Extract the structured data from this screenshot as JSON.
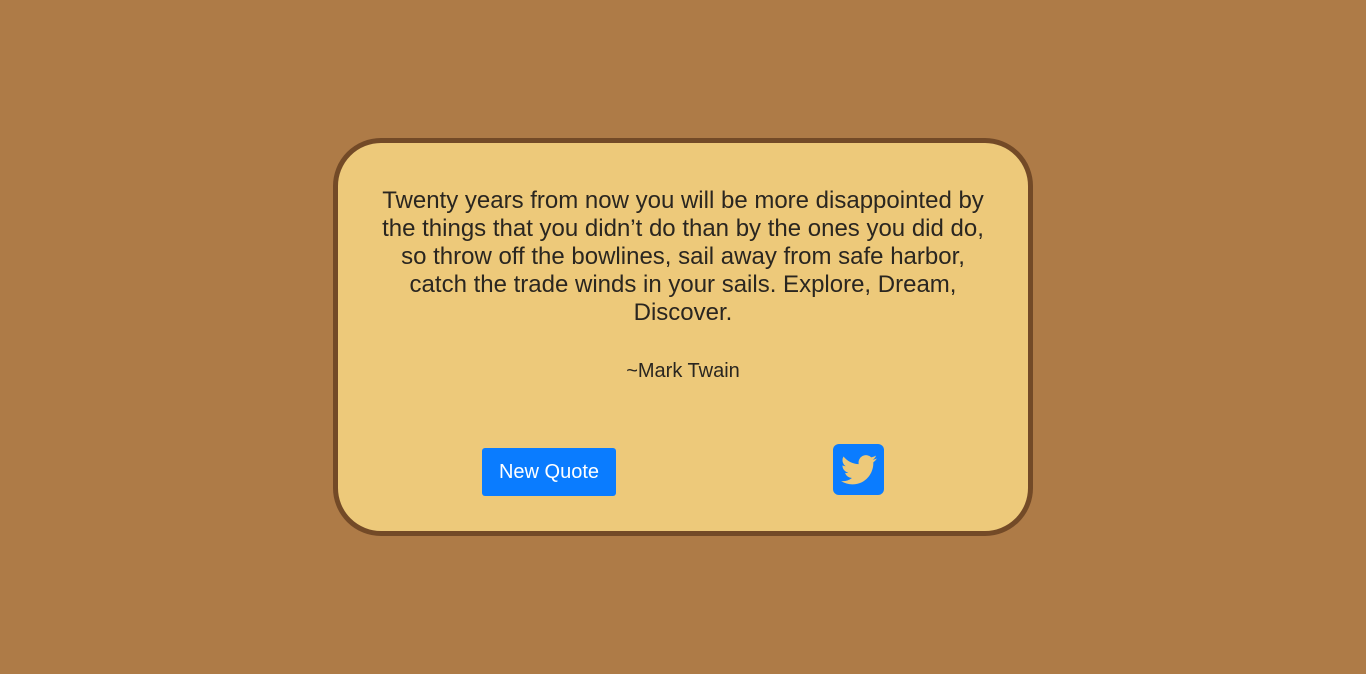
{
  "quote": {
    "text": "Twenty years from now you will be more disappointed by the things that you didn’t do than by the ones you did do, so throw off the bowlines, sail away from safe harbor, catch the trade winds in your sails. Explore, Dream, Discover.",
    "author": "~Mark Twain"
  },
  "buttons": {
    "new_quote_label": "New Quote",
    "tweet_icon": "twitter-bird-icon"
  },
  "colors": {
    "background": "#ae7b47",
    "card": "#edc97a",
    "card_border": "#734a27",
    "accent": "#0a7cff",
    "text": "#2a2620"
  }
}
